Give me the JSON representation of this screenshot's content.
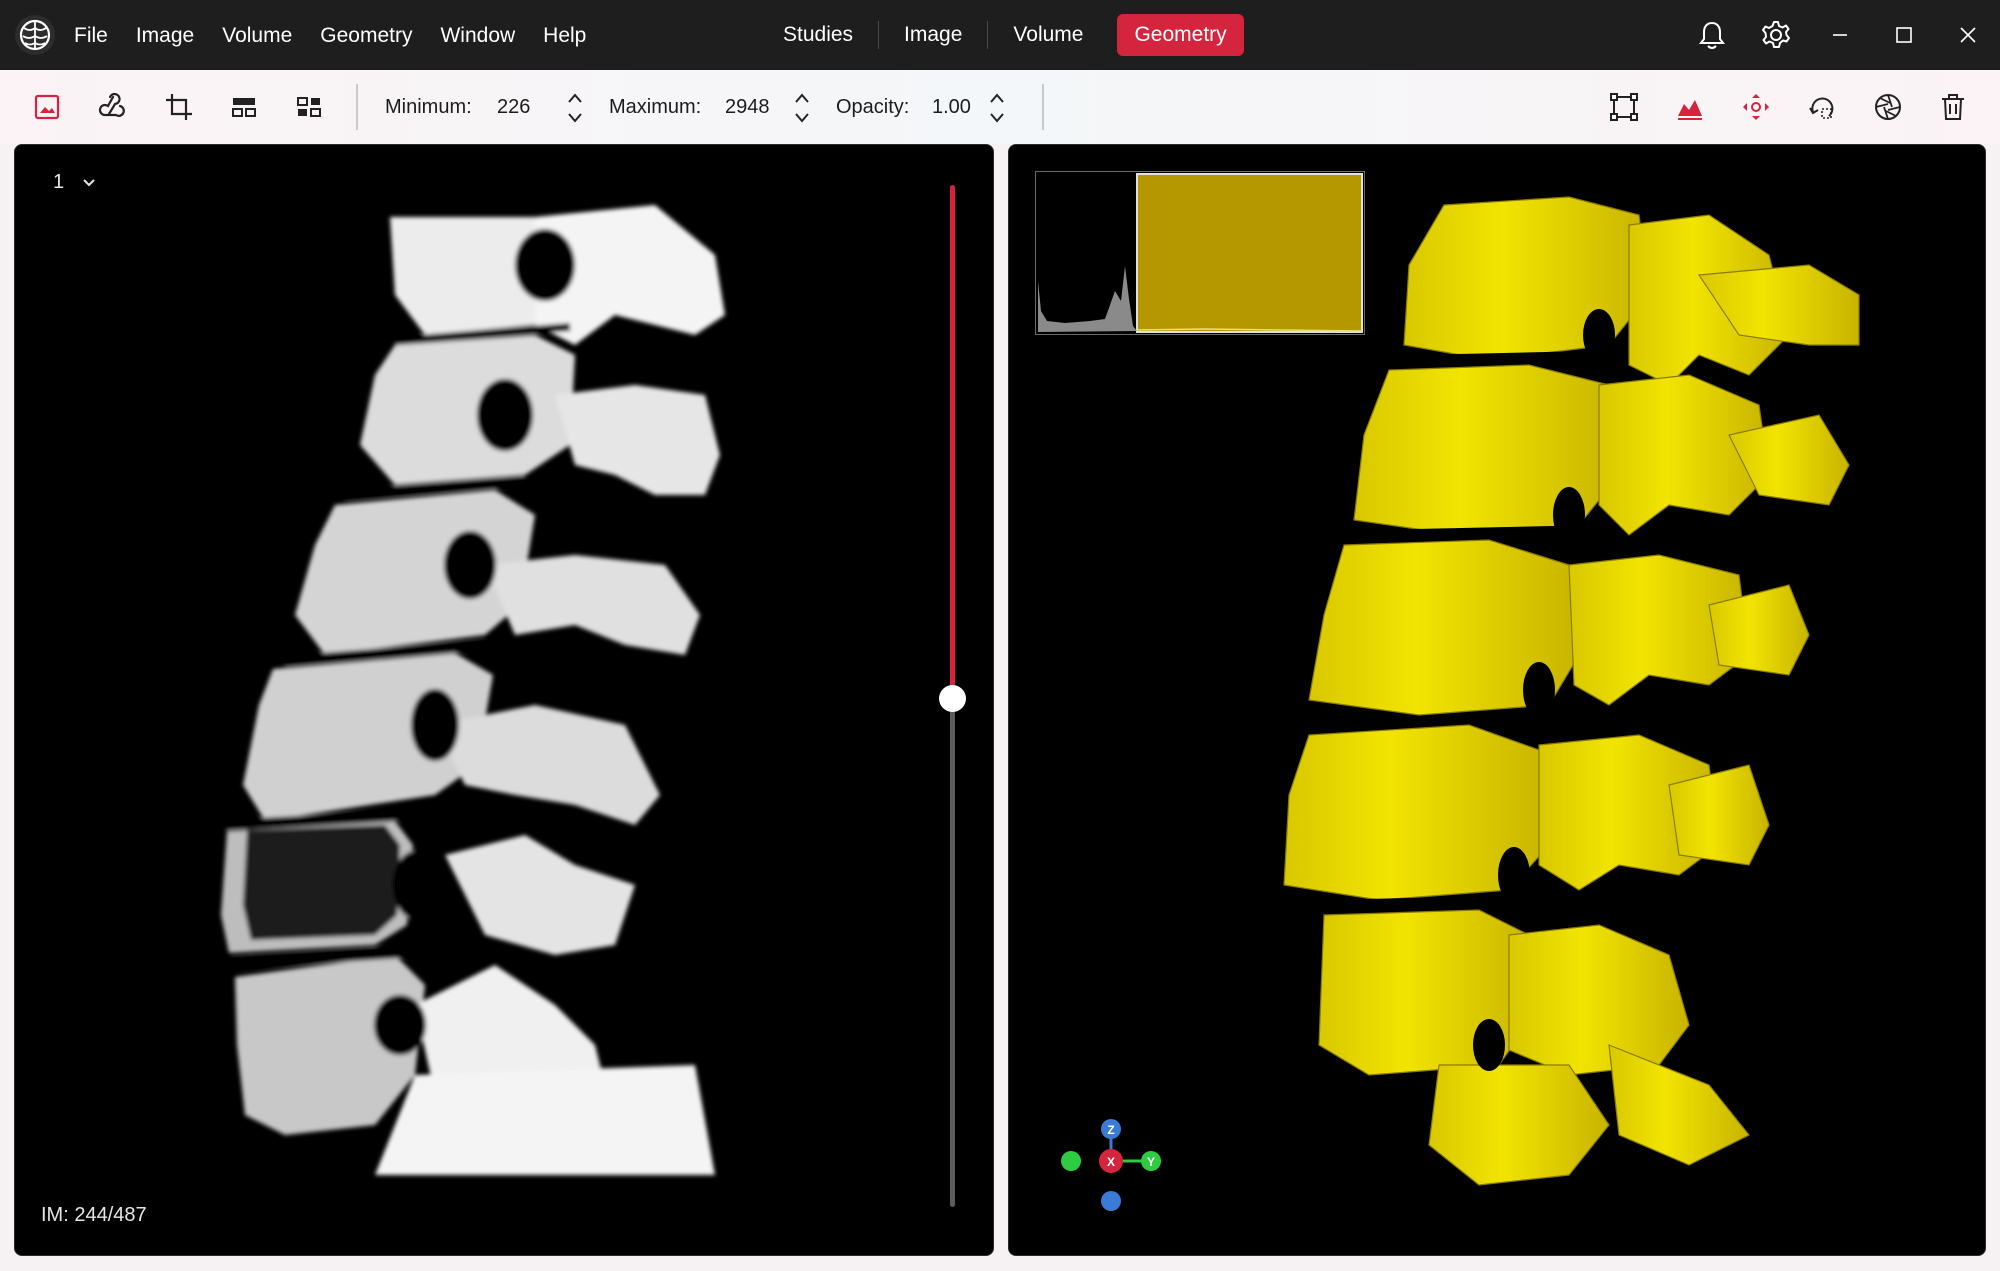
{
  "menu": {
    "items": [
      "File",
      "Image",
      "Volume",
      "Geometry",
      "Window",
      "Help"
    ]
  },
  "modes": {
    "tabs": [
      "Studies",
      "Image",
      "Volume",
      "Geometry"
    ],
    "active": "Geometry"
  },
  "toolbar": {
    "min_label": "Minimum:",
    "min_value": "226",
    "max_label": "Maximum:",
    "max_value": "2948",
    "opacity_label": "Opacity:",
    "opacity_value": "1.00"
  },
  "left_view": {
    "series": "1",
    "slice_info": "IM: 244/487",
    "slice_position": 0.5
  },
  "colors": {
    "accent": "#d4243e",
    "bone": "#e8d800",
    "histogram_fill": "#b59800"
  },
  "icons": {
    "app": "brain-logo-icon",
    "bell": "bell-icon",
    "settings": "gear-icon",
    "minimize": "minimize-icon",
    "maximize": "maximize-icon",
    "close": "close-icon"
  }
}
